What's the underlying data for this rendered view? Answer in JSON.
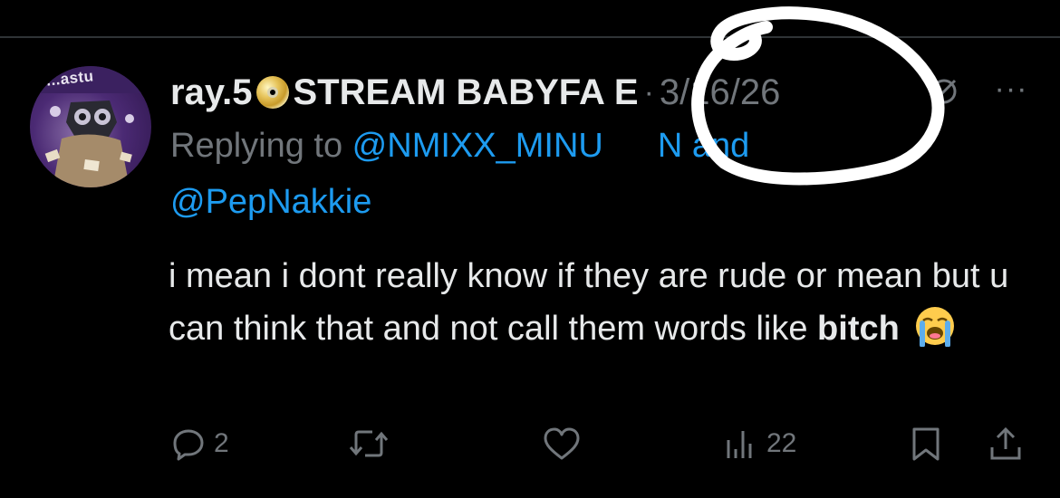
{
  "tweet": {
    "avatar_text": "...astu",
    "display_name_prefix": "ray.5",
    "display_name_suffix": "STREAM BABYFA",
    "display_name_tail": "E",
    "separator": "·",
    "timestamp": "3/16/26",
    "replying_prefix": "Replying to ",
    "mention_one": "@NMIXX_MINU",
    "mention_one_tail": "N",
    "replying_and": " and",
    "mention_two": "@PepNakkie",
    "body_part1": "i mean i dont really know if they are rude or mean but u can think that and not call them words like ",
    "body_bold": "bitch",
    "more_label": "···"
  },
  "actions": {
    "replies": "2",
    "views": "22"
  },
  "colors": {
    "background": "#000000",
    "text": "#e7e9ea",
    "muted": "#71767b",
    "link": "#1d9bf0",
    "scribble": "#ffffff"
  },
  "icons": [
    "cd-icon",
    "grok-icon",
    "more-icon",
    "reply-icon",
    "retweet-icon",
    "like-icon",
    "views-icon",
    "bookmark-icon",
    "share-icon",
    "loudly-crying-face-emoji"
  ]
}
